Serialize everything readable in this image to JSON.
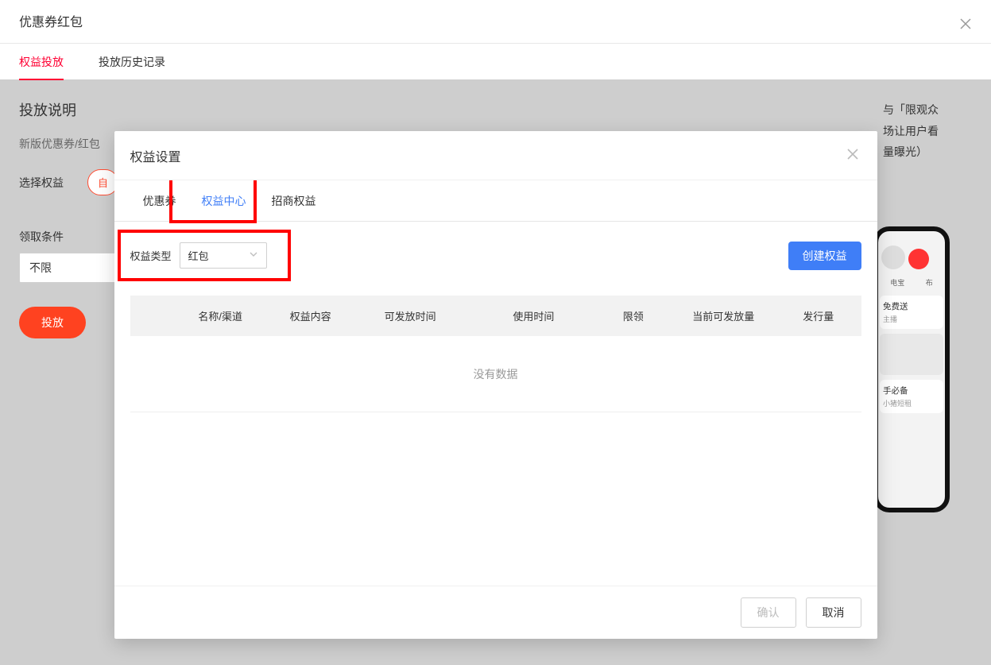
{
  "header": {
    "title": "优惠券红包"
  },
  "tabs": {
    "items": [
      "权益投放",
      "投放历史记录"
    ],
    "active": 0
  },
  "section": {
    "title": "投放说明",
    "desc": "新版优惠券/红包",
    "select_label": "选择权益",
    "select_btn": "自",
    "cond_label": "领取条件",
    "cond_value": "不限",
    "publish_btn": "投放"
  },
  "side_note": {
    "l1": "与「限观众",
    "l2": "场让用户看",
    "l3": "量曝光）"
  },
  "phone": {
    "top": {
      "a": "电宝",
      "b": "布"
    },
    "cards": [
      {
        "title": "免费送",
        "sub": "主播"
      },
      {
        "title": "",
        "sub": ""
      },
      {
        "title": "手必备",
        "sub": "小猪短租"
      }
    ]
  },
  "modal": {
    "title": "权益设置",
    "tabs": [
      "优惠券",
      "权益中心",
      "招商权益"
    ],
    "active_tab": 1,
    "filter_label": "权益类型",
    "filter_value": "红包",
    "create_btn": "创建权益",
    "columns": [
      "名称/渠道",
      "权益内容",
      "可发放时间",
      "使用时间",
      "限领",
      "当前可发放量",
      "发行量"
    ],
    "empty": "没有数据",
    "ok": "确认",
    "cancel": "取消"
  }
}
